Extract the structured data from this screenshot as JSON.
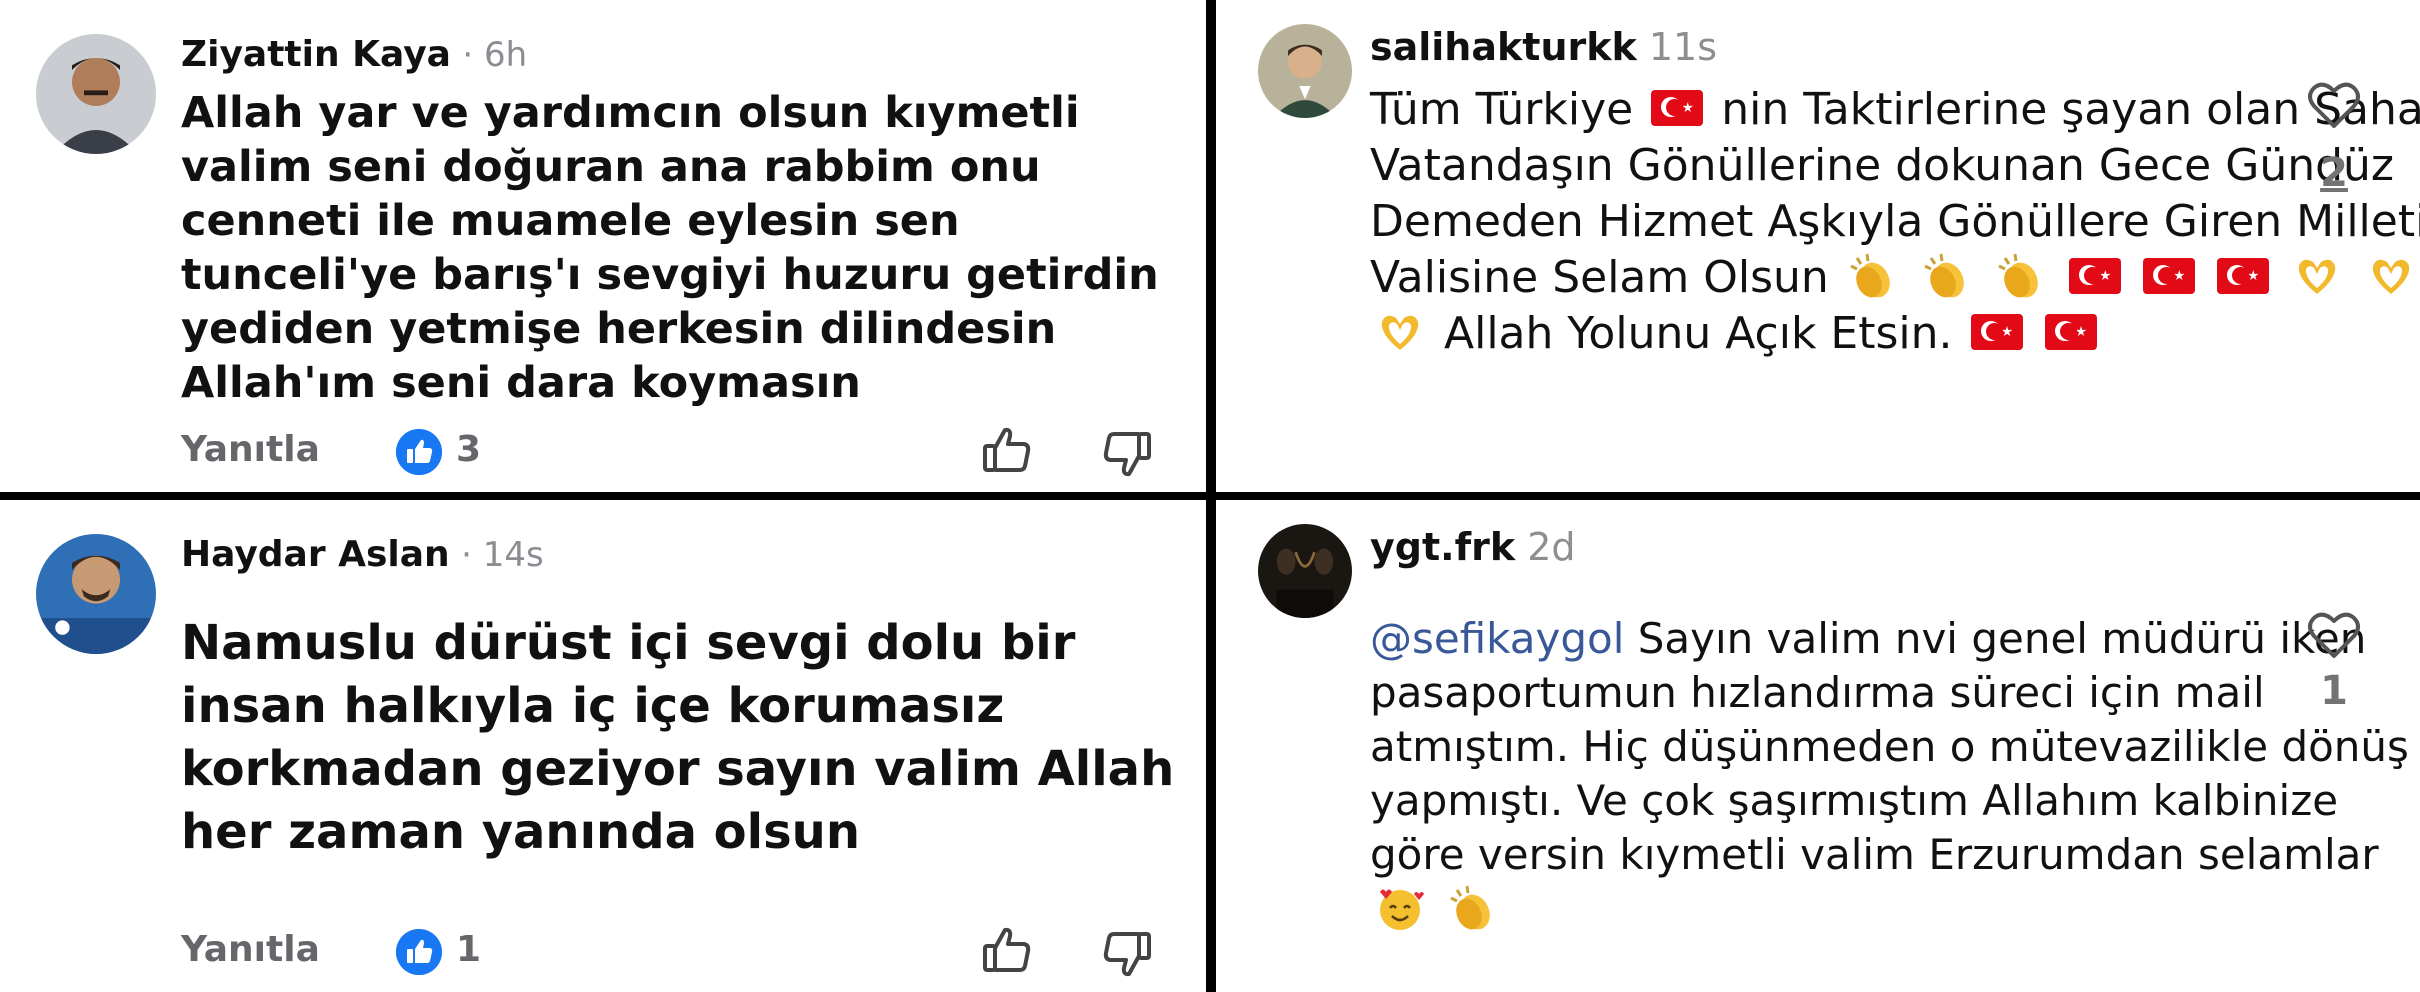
{
  "comments": [
    {
      "author": "Ziyattin Kaya",
      "time": "· 6h",
      "text": "Allah yar ve yardımcın olsun kıymetli valim seni doğuran ana rabbim onu cenneti ile muamele eylesin sen tunceli'ye barış'ı sevgiyi huzuru getirdin yediden yetmişe herkesin dilindesin Allah'ım seni dara koymasın",
      "reply_label": "Yanıtla",
      "like_count": "3"
    },
    {
      "author": "Haydar Aslan",
      "time": "· 14s",
      "text": "Namuslu dürüst içi sevgi dolu bir insan halkıyla iç içe korumasız korkmadan geziyor sayın valim Allah her zaman yanında olsun",
      "reply_label": "Yanıtla",
      "like_count": "1"
    },
    {
      "author": "salihakturkk",
      "time": "11s",
      "text_parts": [
        "Tüm Türkiye",
        "nin Taktirlerine şayan olan Sahada Vatandaşın Gönüllerine dokunan Gece Gündüz Demeden Hizmet Aşkıyla Gönüllere Giren Milletin Valisine Selam Olsun",
        "Allah Yolunu Açık Etsin."
      ],
      "heart_count": "2"
    },
    {
      "author": "ygt.frk",
      "time": "2d",
      "mention": "@sefikaygol",
      "text": "Sayın valim nvi genel müdürü iken pasaportumun hızlandırma süreci için mail atmıştım. Hiç düşünmeden o mütevazilikle dönüş yapmıştı. Ve çok şaşırmıştım Allahım kalbinize göre versin kıymetli valim Erzurumdan selamlar",
      "heart_count": "1"
    }
  ],
  "icons": {
    "like_badge": "thumbs-up-filled-icon",
    "like": "thumbs-up-outline-icon",
    "dislike": "thumbs-down-outline-icon",
    "heart": "heart-outline-icon",
    "flag": "turkish-flag-emoji",
    "clap": "clapping-hands-emoji",
    "heart_hands": "heart-hands-emoji",
    "smile_hearts": "smiling-face-with-hearts-emoji"
  },
  "colors": {
    "facebook_blue": "#1877f2",
    "mention_blue": "#385898",
    "muted_gray": "#65676b",
    "divider": "#000000"
  }
}
